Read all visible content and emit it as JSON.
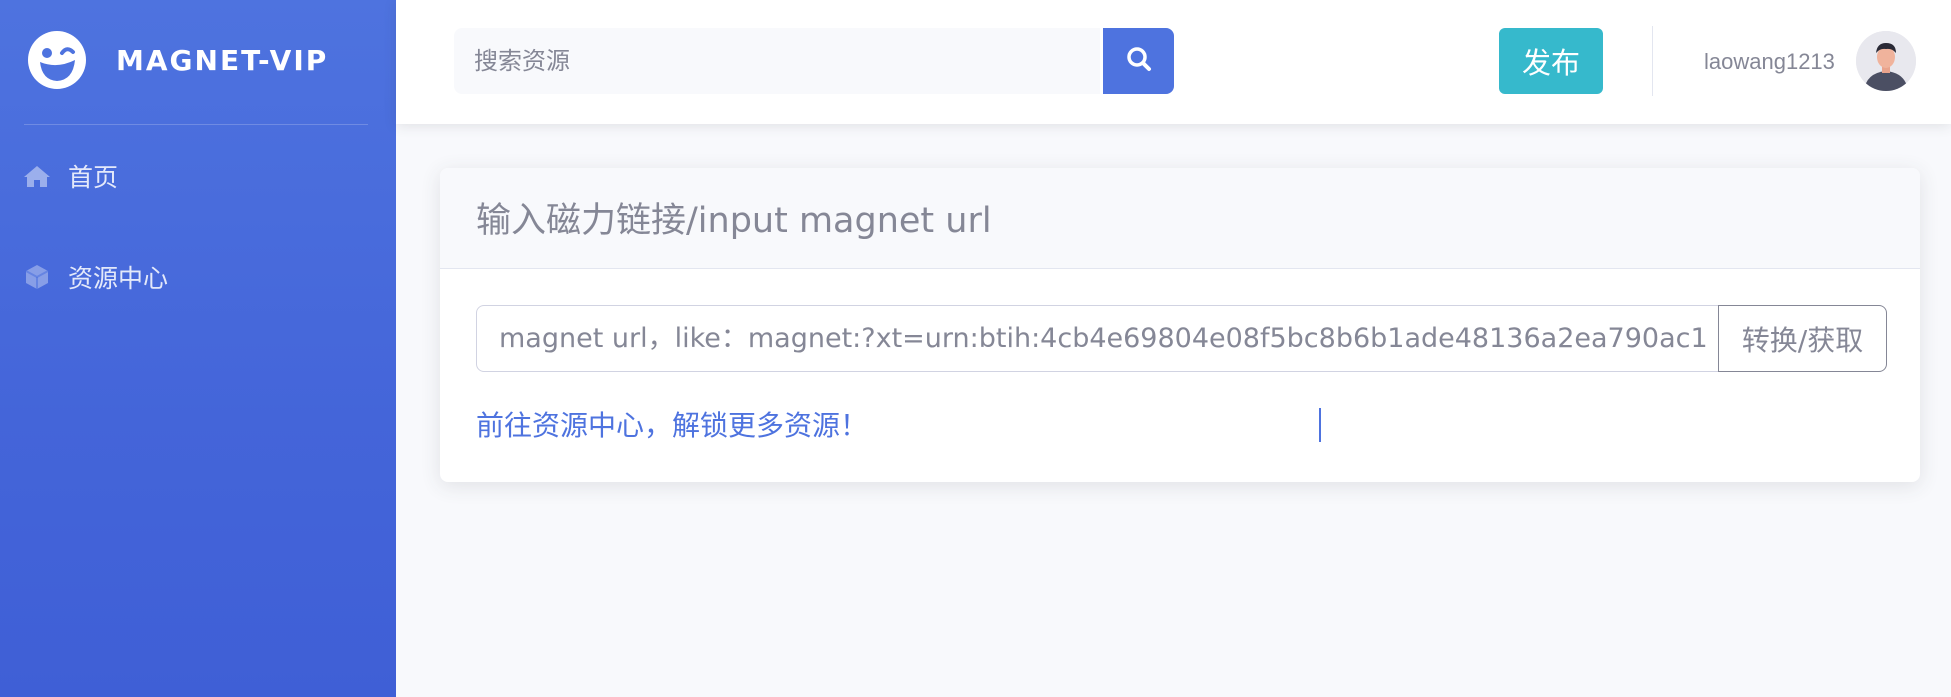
{
  "brand": {
    "name": "MAGNET-VIP",
    "icon": "laughing-wink-icon"
  },
  "sidebar": {
    "items": [
      {
        "label": "首页",
        "icon": "home-icon"
      },
      {
        "label": "资源中心",
        "icon": "cube-icon"
      }
    ]
  },
  "topbar": {
    "search": {
      "placeholder": "搜索资源",
      "icon": "search-icon"
    },
    "publish_label": "发布",
    "username": "laowang1213",
    "avatar_icon": "user-avatar"
  },
  "card": {
    "title": "输入磁力链接/input magnet url",
    "magnet_placeholder": "magnet url，like：magnet:?xt=urn:btih:4cb4e69804e08f5bc8b6b1ade48136a2ea790ac1",
    "convert_label": "转换/获取",
    "link_text": "前往资源中心，解锁更多资源！"
  },
  "colors": {
    "primary": "#4e73df",
    "info": "#36b9cc",
    "gray_text": "#858796",
    "background": "#f8f9fc"
  }
}
